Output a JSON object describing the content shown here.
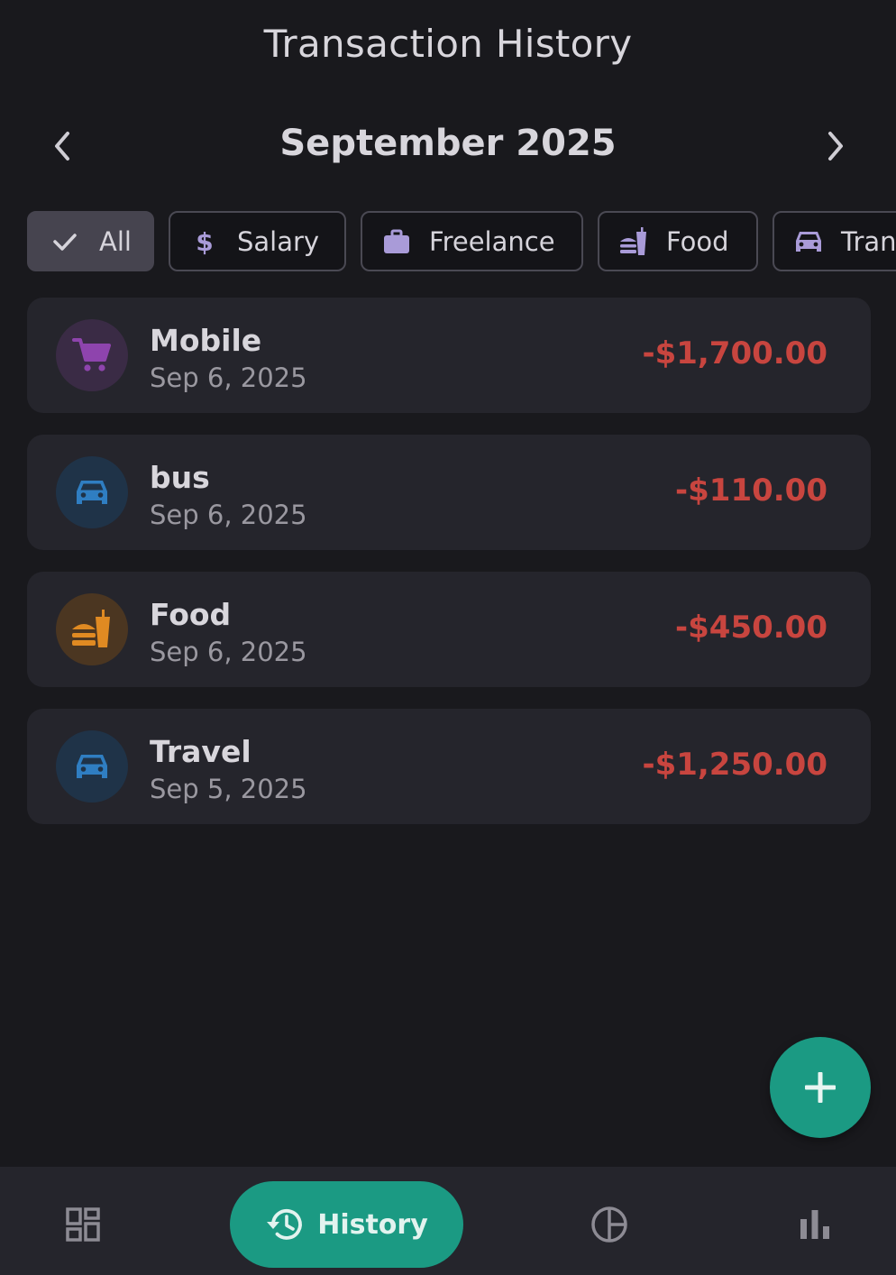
{
  "header": {
    "title": "Transaction History"
  },
  "month_nav": {
    "label": "September 2025",
    "prev_icon": "chevron-left-icon",
    "next_icon": "chevron-right-icon"
  },
  "filters": [
    {
      "label": "All",
      "icon": "check-icon",
      "selected": true
    },
    {
      "label": "Salary",
      "icon": "dollar-icon",
      "selected": false
    },
    {
      "label": "Freelance",
      "icon": "briefcase-icon",
      "selected": false
    },
    {
      "label": "Food",
      "icon": "fastfood-icon",
      "selected": false
    },
    {
      "label": "Tran",
      "icon": "car-icon",
      "selected": false
    }
  ],
  "transactions": [
    {
      "name": "Mobile",
      "date": "Sep 6, 2025",
      "amount": "-$1,700.00",
      "icon": "shopping-cart-icon",
      "icon_color": "#8e44ad",
      "avatar_bg": "#3a2b45"
    },
    {
      "name": "bus",
      "date": "Sep 6, 2025",
      "amount": "-$110.00",
      "icon": "car-icon",
      "icon_color": "#2f7ec2",
      "avatar_bg": "#1f3348"
    },
    {
      "name": "Food",
      "date": "Sep 6, 2025",
      "amount": "-$450.00",
      "icon": "fastfood-icon",
      "icon_color": "#e08a22",
      "avatar_bg": "#4b3621"
    },
    {
      "name": "Travel",
      "date": "Sep 5, 2025",
      "amount": "-$1,250.00",
      "icon": "car-icon",
      "icon_color": "#2f7ec2",
      "avatar_bg": "#1f3348"
    }
  ],
  "bottom_nav": {
    "items": [
      {
        "label": "",
        "icon": "dashboard-icon",
        "active": false
      },
      {
        "label": "History",
        "icon": "history-icon",
        "active": true
      },
      {
        "label": "",
        "icon": "pie-chart-icon",
        "active": false
      },
      {
        "label": "",
        "icon": "bar-chart-icon",
        "active": false
      }
    ]
  },
  "fab": {
    "icon": "plus-icon"
  },
  "colors": {
    "background": "#19191d",
    "card": "#25252c",
    "accent": "#1b9a83",
    "expense": "#c8453f",
    "chip_icon": "#a99bd8"
  }
}
